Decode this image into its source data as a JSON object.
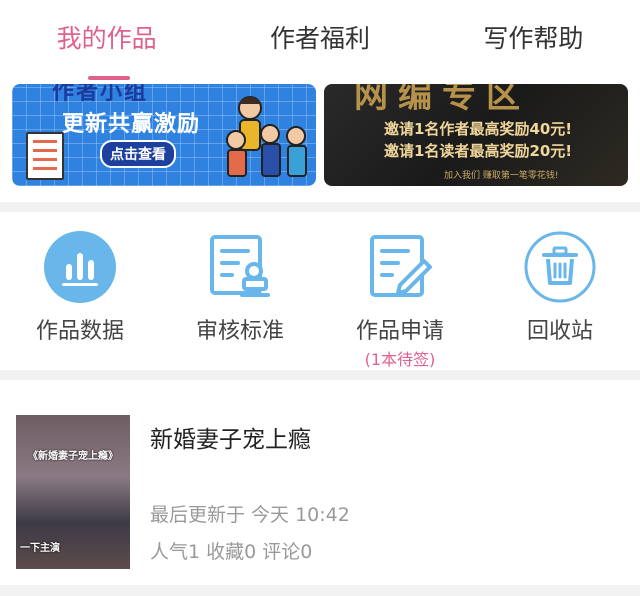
{
  "tabs": [
    {
      "label": "我的作品",
      "active": true
    },
    {
      "label": "作者福利",
      "active": false
    },
    {
      "label": "写作帮助",
      "active": false
    }
  ],
  "banners": {
    "left": {
      "title": "作者小组",
      "line2": "更新共赢激励",
      "button": "点击查看"
    },
    "right": {
      "title": "网编专区",
      "line1": "邀请1名作者最高奖励40元!",
      "line2": "邀请1名读者最高奖励20元!",
      "footer": "加入我们  赚取第一笔零花钱!"
    }
  },
  "shortcuts": [
    {
      "label": "作品数据",
      "icon": "bar-chart-icon",
      "sub": ""
    },
    {
      "label": "审核标准",
      "icon": "review-stamp-icon",
      "sub": ""
    },
    {
      "label": "作品申请",
      "icon": "edit-document-icon",
      "sub": "(1本待签)"
    },
    {
      "label": "回收站",
      "icon": "trash-icon",
      "sub": ""
    }
  ],
  "work": {
    "title": "新婚妻子宠上瘾",
    "last_update": "最后更新于 今天 10:42",
    "stats": "人气1 收藏0 评论0",
    "cover_text_top": "《新婚妻子宠上瘾》",
    "cover_text_bottom": "一下主演"
  },
  "colors": {
    "accent": "#e0628c",
    "icon_blue": "#68b6ea"
  }
}
